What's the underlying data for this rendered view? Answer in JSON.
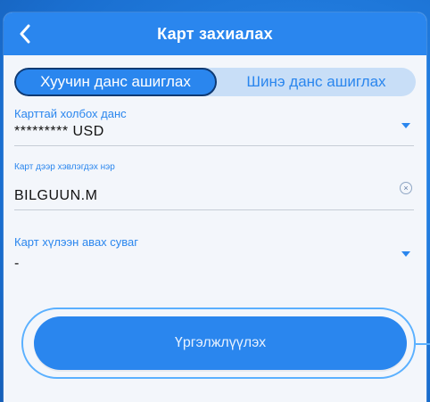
{
  "header": {
    "title": "Карт захиалах",
    "back_icon": "chevron-left-icon"
  },
  "segment": {
    "options": [
      {
        "label": "Хуучин данс ашиглах",
        "selected": true
      },
      {
        "label": "Шинэ данс ашиглах",
        "selected": false
      }
    ]
  },
  "form": {
    "account": {
      "label": "Карттай холбох данс",
      "value": "********* USD"
    },
    "card_name": {
      "label": "Карт дээр хэвлэгдэх нэр",
      "value": "BILGUUN.M"
    },
    "channel": {
      "label": "Карт хүлээн авах суваг",
      "value": "-"
    }
  },
  "actions": {
    "continue_label": "Үргэлжлүүлэх"
  },
  "colors": {
    "accent": "#2a86ee",
    "background": "#1f7ee0",
    "panel": "#f3f6fb"
  }
}
